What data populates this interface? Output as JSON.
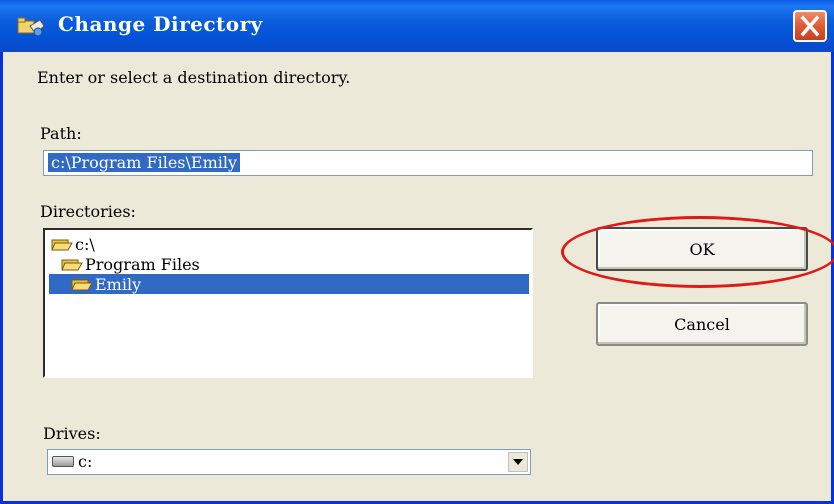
{
  "window": {
    "title": "Change Directory",
    "icon": "folder-exchange-icon"
  },
  "dialog": {
    "instruction": "Enter or select a destination directory.",
    "path_label": "Path:",
    "path_value": "c:\\Program Files\\Emily",
    "directories_label": "Directories:",
    "directories": [
      {
        "label": "c:\\",
        "level": 0,
        "selected": false
      },
      {
        "label": "Program Files",
        "level": 1,
        "selected": false
      },
      {
        "label": "Emily",
        "level": 2,
        "selected": true
      }
    ],
    "drives_label": "Drives:",
    "drive_value": "c:"
  },
  "buttons": {
    "ok": "OK",
    "cancel": "Cancel"
  },
  "colors": {
    "titlebar": "#0453d8",
    "selection": "#316ac5",
    "highlight_circle": "#e01818",
    "close_button": "#e05a36"
  }
}
